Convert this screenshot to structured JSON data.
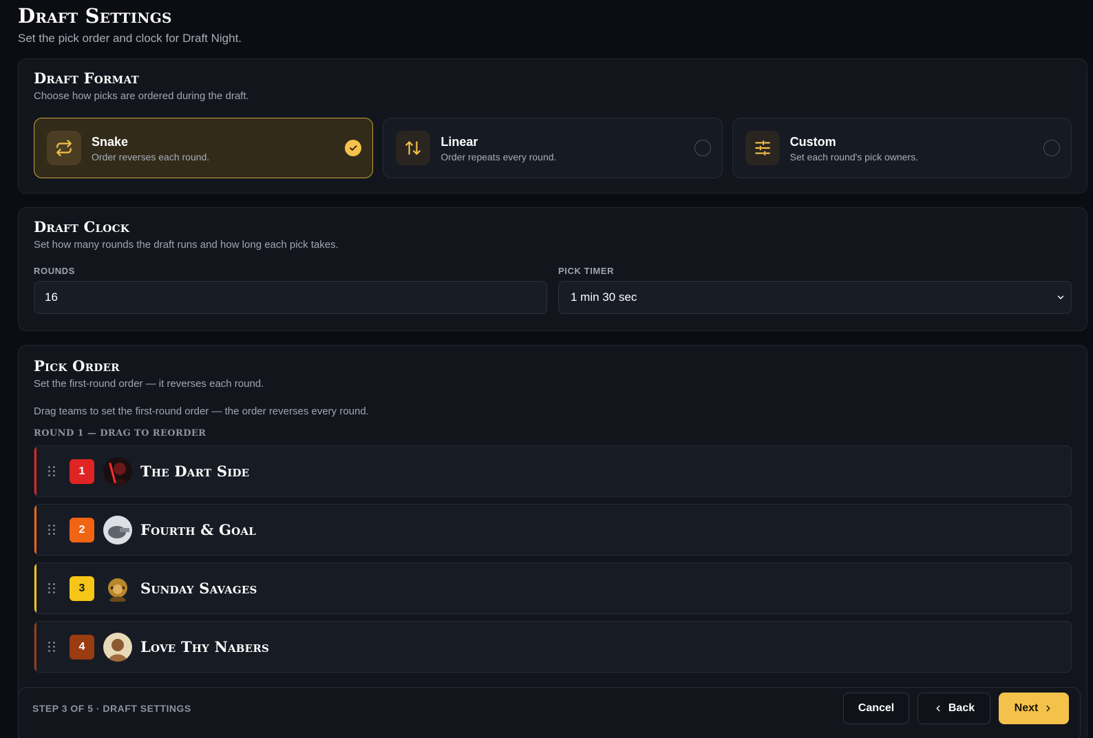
{
  "header": {
    "title": "Draft Settings",
    "subtitle": "Set the pick order and clock for Draft Night."
  },
  "draft_format": {
    "title": "Draft Format",
    "description": "Choose how picks are ordered during the draft.",
    "options": [
      {
        "label": "Snake",
        "description": "Order reverses each round.",
        "icon": "repeat-icon",
        "selected": true
      },
      {
        "label": "Linear",
        "description": "Order repeats every round.",
        "icon": "arrows-up-down-icon",
        "selected": false
      },
      {
        "label": "Custom",
        "description": "Set each round's pick owners.",
        "icon": "sliders-icon",
        "selected": false
      }
    ]
  },
  "draft_clock": {
    "title": "Draft Clock",
    "description": "Set how many rounds the draft runs and how long each pick takes.",
    "rounds_label": "ROUNDS",
    "rounds_value": "16",
    "timer_label": "PICK TIMER",
    "timer_value": "1 min 30 sec"
  },
  "pick_order": {
    "title": "Pick Order",
    "description": "Set the first-round order — it reverses each round.",
    "hint": "Drag teams to set the first-round order — the order reverses every round.",
    "round_label": "ROUND 1 — DRAG TO REORDER",
    "teams": [
      {
        "seed": "1",
        "name": "The Dart Side",
        "color": "#e02424"
      },
      {
        "seed": "2",
        "name": "Fourth & Goal",
        "color": "#f06414"
      },
      {
        "seed": "3",
        "name": "Sunday Savages",
        "color": "#f5c518"
      },
      {
        "seed": "4",
        "name": "Love Thy Nabers",
        "color": "#9a3c12"
      }
    ]
  },
  "footer": {
    "step": "STEP 3 OF 5 · DRAFT SETTINGS",
    "cancel": "Cancel",
    "back": "Back",
    "next": "Next"
  },
  "colors": {
    "accent": "#f4c24a",
    "background": "#0b0d12",
    "card": "#12151c"
  }
}
